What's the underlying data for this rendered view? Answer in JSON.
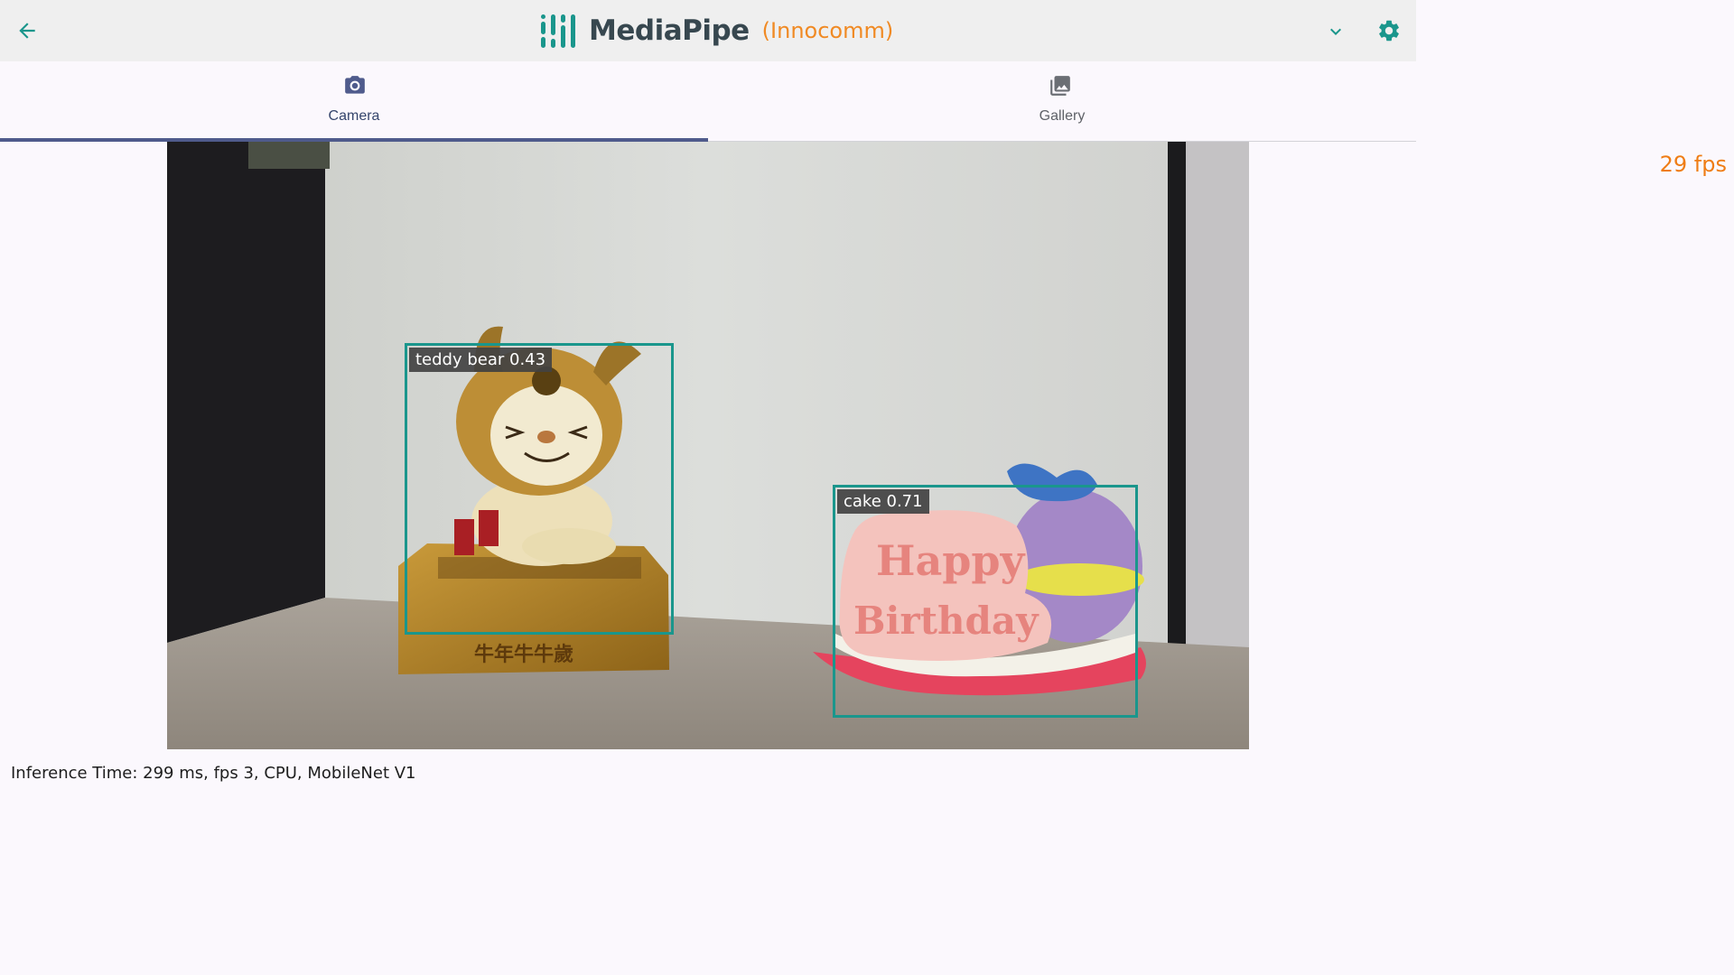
{
  "header": {
    "title": "MediaPipe",
    "device": "(Innocomm)",
    "back_icon": "arrow-back-icon",
    "dropdown_icon": "chevron-down-icon",
    "settings_icon": "gear-icon",
    "title_color": "#37474f",
    "accent_color": "#f08a24",
    "logo_color": "#1a968c"
  },
  "tabs": [
    {
      "label": "Camera",
      "icon": "camera-icon",
      "selected": true
    },
    {
      "label": "Gallery",
      "icon": "gallery-icon",
      "selected": false
    }
  ],
  "preview": {
    "fps": "29 fps",
    "detections": [
      {
        "label": "teddy bear 0.43",
        "category": "teddy bear",
        "score": 0.43
      },
      {
        "label": "cake 0.71",
        "category": "cake",
        "score": 0.71
      }
    ],
    "box_color": "#1a968c"
  },
  "status": {
    "text": "Inference Time: 299 ms, fps 3, CPU, MobileNet V1"
  }
}
